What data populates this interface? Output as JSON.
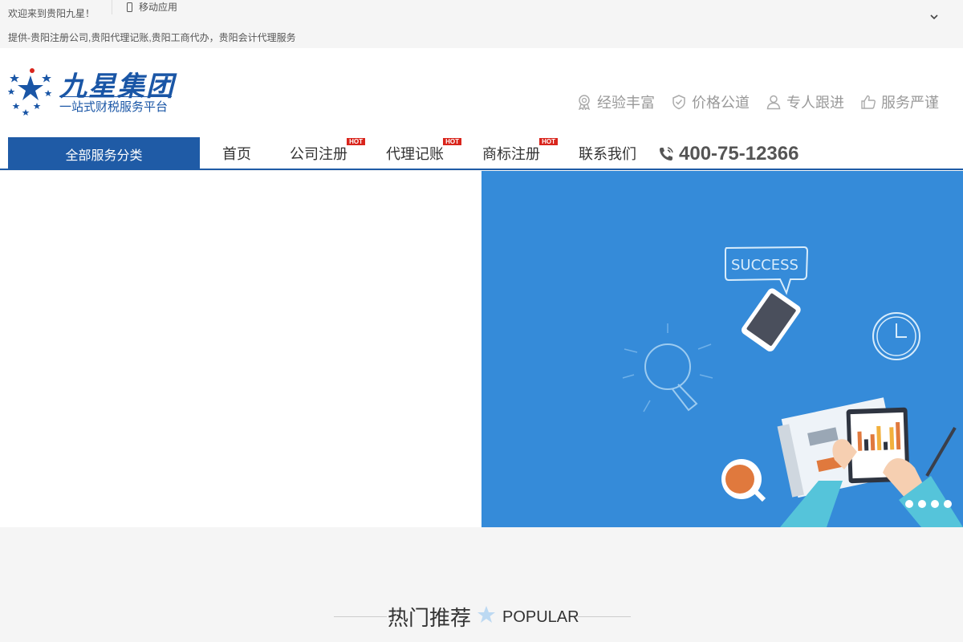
{
  "topbar": {
    "welcome": "欢迎来到贵阳九星！",
    "mobile_label": "移动应用",
    "tagline": "提供-贵阳注册公司,贵阳代理记账,贵阳工商代办，贵阳会计代理服务"
  },
  "logo": {
    "title": "九星集团",
    "subtitle": "一站式财税服务平台"
  },
  "features": [
    {
      "icon": "award-icon",
      "label": "经验丰富"
    },
    {
      "icon": "shield-check-icon",
      "label": "价格公道"
    },
    {
      "icon": "user-icon",
      "label": "专人跟进"
    },
    {
      "icon": "thumbs-up-icon",
      "label": "服务严谨"
    }
  ],
  "nav": {
    "all_services": "全部服务分类",
    "items": [
      {
        "label": "首页",
        "hot": ""
      },
      {
        "label": "公司注册",
        "hot": "HOT"
      },
      {
        "label": "代理记账",
        "hot": "HOT"
      },
      {
        "label": "商标注册",
        "hot": "HOT"
      },
      {
        "label": "联系我们",
        "hot": ""
      }
    ],
    "hotline": "400-75-12366"
  },
  "banner": {
    "bubble_text": "SUCCESS",
    "slide_count": 4
  },
  "popular": {
    "title": "热门推荐",
    "subtitle": "POPULAR"
  },
  "colors": {
    "brand_blue": "#1f5ba6",
    "banner_blue": "#358bd9",
    "hot_red": "#d9251c"
  }
}
